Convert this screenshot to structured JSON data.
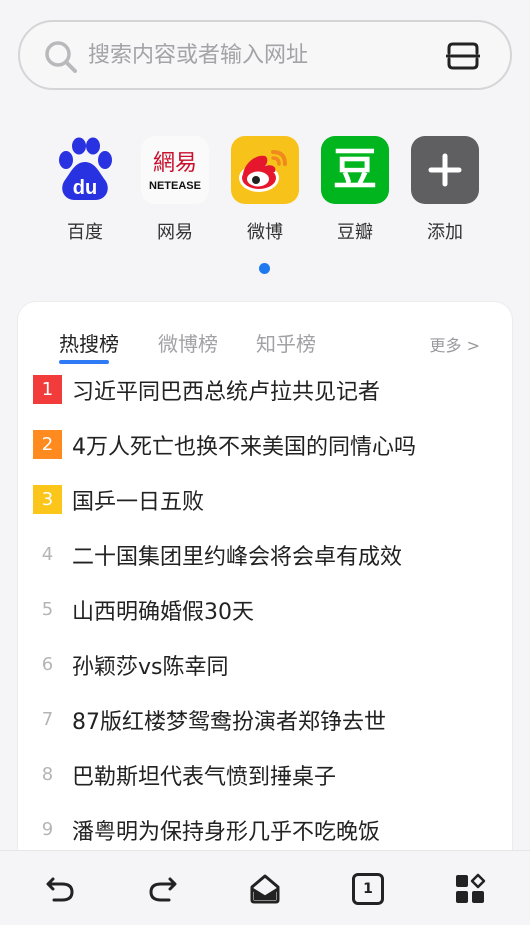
{
  "search": {
    "placeholder": "搜索内容或者输入网址"
  },
  "shortcuts": [
    {
      "label": "百度",
      "icon": "baidu-icon",
      "color": "#2932e1"
    },
    {
      "label": "网易",
      "icon": "netease-icon",
      "logo_text_top": "網易",
      "logo_text_bottom": "NETEASE",
      "color": "#c8102e"
    },
    {
      "label": "微博",
      "icon": "weibo-icon",
      "color": "#f7c21a"
    },
    {
      "label": "豆瓣",
      "icon": "douban-icon",
      "logo_text": "豆",
      "color": "#00b51d"
    },
    {
      "label": "添加",
      "icon": "add-icon",
      "color": "#5f5f61"
    }
  ],
  "hotlist": {
    "tabs": [
      "热搜榜",
      "微博榜",
      "知乎榜"
    ],
    "active_tab": 0,
    "more_label": "更多 >",
    "items": [
      {
        "rank": "1",
        "title": "习近平同巴西总统卢拉共见记者",
        "badge_color": "#f23c3c"
      },
      {
        "rank": "2",
        "title": "4万人死亡也换不来美国的同情心吗",
        "badge_color": "#ff8a1f"
      },
      {
        "rank": "3",
        "title": "国乒一日五败",
        "badge_color": "#fbc51a"
      },
      {
        "rank": "4",
        "title": "二十国集团里约峰会将会卓有成效"
      },
      {
        "rank": "5",
        "title": "山西明确婚假30天"
      },
      {
        "rank": "6",
        "title": "孙颖莎vs陈幸同"
      },
      {
        "rank": "7",
        "title": "87版红楼梦鸳鸯扮演者郑铮去世"
      },
      {
        "rank": "8",
        "title": "巴勒斯坦代表气愤到捶桌子"
      },
      {
        "rank": "9",
        "title": "潘粤明为保持身形几乎不吃晚饭"
      }
    ]
  },
  "toolbar": {
    "tab_count": "1",
    "icons": [
      "back-icon",
      "forward-icon",
      "home-icon",
      "tabs-icon",
      "apps-icon"
    ]
  }
}
